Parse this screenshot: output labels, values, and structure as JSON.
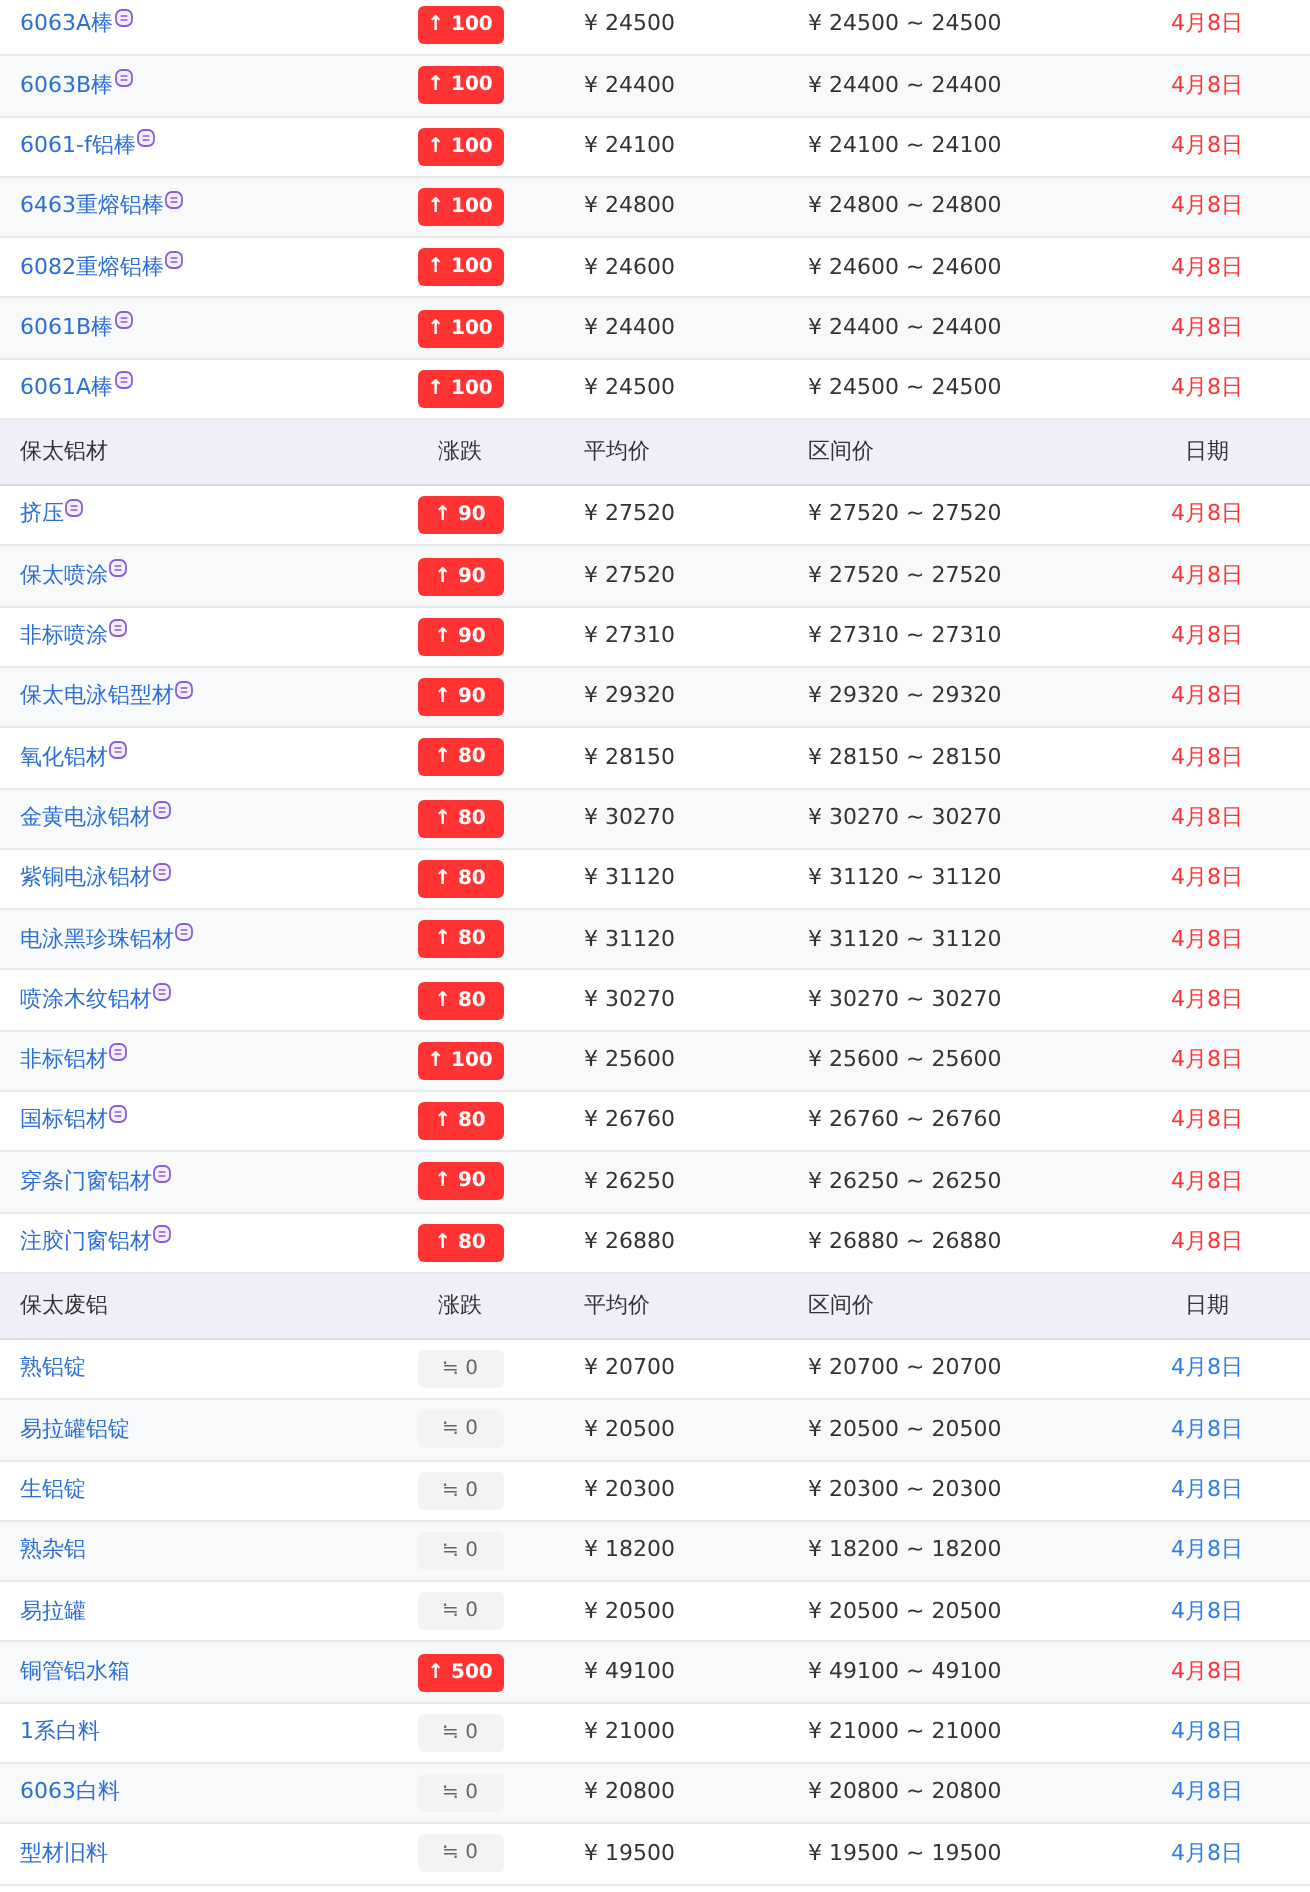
{
  "sections": [
    {
      "rows": [
        {
          "name": "6063A棒",
          "icon": true,
          "kind": "up",
          "change": "↑ 100",
          "avg": "¥ 24500",
          "range": "¥ 24500 ~ 24500",
          "date": "4月8日"
        },
        {
          "name": "6063B棒",
          "icon": true,
          "kind": "up",
          "change": "↑ 100",
          "avg": "¥ 24400",
          "range": "¥ 24400 ~ 24400",
          "date": "4月8日"
        },
        {
          "name": "6061-f铝棒",
          "icon": true,
          "kind": "up",
          "change": "↑ 100",
          "avg": "¥ 24100",
          "range": "¥ 24100 ~ 24100",
          "date": "4月8日"
        },
        {
          "name": "6463重熔铝棒",
          "icon": true,
          "kind": "up",
          "change": "↑ 100",
          "avg": "¥ 24800",
          "range": "¥ 24800 ~ 24800",
          "date": "4月8日"
        },
        {
          "name": "6082重熔铝棒",
          "icon": true,
          "kind": "up",
          "change": "↑ 100",
          "avg": "¥ 24600",
          "range": "¥ 24600 ~ 24600",
          "date": "4月8日"
        },
        {
          "name": "6061B棒",
          "icon": true,
          "kind": "up",
          "change": "↑ 100",
          "avg": "¥ 24400",
          "range": "¥ 24400 ~ 24400",
          "date": "4月8日"
        },
        {
          "name": "6061A棒",
          "icon": true,
          "kind": "up",
          "change": "↑ 100",
          "avg": "¥ 24500",
          "range": "¥ 24500 ~ 24500",
          "date": "4月8日"
        }
      ]
    },
    {
      "header": [
        "保太铝材",
        "涨跌",
        "平均价",
        "区间价",
        "日期"
      ],
      "rows": [
        {
          "name": "挤压",
          "icon": true,
          "kind": "up",
          "change": "↑ 90",
          "avg": "¥ 27520",
          "range": "¥ 27520 ~ 27520",
          "date": "4月8日"
        },
        {
          "name": "保太喷涂",
          "icon": true,
          "kind": "up",
          "change": "↑ 90",
          "avg": "¥ 27520",
          "range": "¥ 27520 ~ 27520",
          "date": "4月8日"
        },
        {
          "name": "非标喷涂",
          "icon": true,
          "kind": "up",
          "change": "↑ 90",
          "avg": "¥ 27310",
          "range": "¥ 27310 ~ 27310",
          "date": "4月8日"
        },
        {
          "name": "保太电泳铝型材",
          "icon": true,
          "kind": "up",
          "change": "↑ 90",
          "avg": "¥ 29320",
          "range": "¥ 29320 ~ 29320",
          "date": "4月8日"
        },
        {
          "name": "氧化铝材",
          "icon": true,
          "kind": "up",
          "change": "↑ 80",
          "avg": "¥ 28150",
          "range": "¥ 28150 ~ 28150",
          "date": "4月8日"
        },
        {
          "name": "金黄电泳铝材",
          "icon": true,
          "kind": "up",
          "change": "↑ 80",
          "avg": "¥ 30270",
          "range": "¥ 30270 ~ 30270",
          "date": "4月8日"
        },
        {
          "name": "紫铜电泳铝材",
          "icon": true,
          "kind": "up",
          "change": "↑ 80",
          "avg": "¥ 31120",
          "range": "¥ 31120 ~ 31120",
          "date": "4月8日"
        },
        {
          "name": "电泳黑珍珠铝材",
          "icon": true,
          "kind": "up",
          "change": "↑ 80",
          "avg": "¥ 31120",
          "range": "¥ 31120 ~ 31120",
          "date": "4月8日"
        },
        {
          "name": "喷涂木纹铝材",
          "icon": true,
          "kind": "up",
          "change": "↑ 80",
          "avg": "¥ 30270",
          "range": "¥ 30270 ~ 30270",
          "date": "4月8日"
        },
        {
          "name": "非标铝材",
          "icon": true,
          "kind": "up",
          "change": "↑ 100",
          "avg": "¥ 25600",
          "range": "¥ 25600 ~ 25600",
          "date": "4月8日"
        },
        {
          "name": "国标铝材",
          "icon": true,
          "kind": "up",
          "change": "↑ 80",
          "avg": "¥ 26760",
          "range": "¥ 26760 ~ 26760",
          "date": "4月8日"
        },
        {
          "name": "穿条门窗铝材",
          "icon": true,
          "kind": "up",
          "change": "↑ 90",
          "avg": "¥ 26250",
          "range": "¥ 26250 ~ 26250",
          "date": "4月8日"
        },
        {
          "name": "注胶门窗铝材",
          "icon": true,
          "kind": "up",
          "change": "↑ 80",
          "avg": "¥ 26880",
          "range": "¥ 26880 ~ 26880",
          "date": "4月8日"
        }
      ]
    },
    {
      "header": [
        "保太废铝",
        "涨跌",
        "平均价",
        "区间价",
        "日期"
      ],
      "rows": [
        {
          "name": "熟铝锭",
          "icon": false,
          "kind": "flat",
          "change": "≒ 0",
          "avg": "¥ 20700",
          "range": "¥ 20700 ~ 20700",
          "date": "4月8日"
        },
        {
          "name": "易拉罐铝锭",
          "icon": false,
          "kind": "flat",
          "change": "≒ 0",
          "avg": "¥ 20500",
          "range": "¥ 20500 ~ 20500",
          "date": "4月8日"
        },
        {
          "name": "生铝锭",
          "icon": false,
          "kind": "flat",
          "change": "≒ 0",
          "avg": "¥ 20300",
          "range": "¥ 20300 ~ 20300",
          "date": "4月8日"
        },
        {
          "name": "熟杂铝",
          "icon": false,
          "kind": "flat",
          "change": "≒ 0",
          "avg": "¥ 18200",
          "range": "¥ 18200 ~ 18200",
          "date": "4月8日"
        },
        {
          "name": "易拉罐",
          "icon": false,
          "kind": "flat",
          "change": "≒ 0",
          "avg": "¥ 20500",
          "range": "¥ 20500 ~ 20500",
          "date": "4月8日"
        },
        {
          "name": "铜管铝水箱",
          "icon": false,
          "kind": "up",
          "change": "↑ 500",
          "avg": "¥ 49100",
          "range": "¥ 49100 ~ 49100",
          "date": "4月8日"
        },
        {
          "name": "1系白料",
          "icon": false,
          "kind": "flat",
          "change": "≒ 0",
          "avg": "¥ 21000",
          "range": "¥ 21000 ~ 21000",
          "date": "4月8日"
        },
        {
          "name": "6063白料",
          "icon": false,
          "kind": "flat",
          "change": "≒ 0",
          "avg": "¥ 20800",
          "range": "¥ 20800 ~ 20800",
          "date": "4月8日"
        },
        {
          "name": "型材旧料",
          "icon": false,
          "kind": "flat",
          "change": "≒ 0",
          "avg": "¥ 19500",
          "range": "¥ 19500 ~ 19500",
          "date": "4月8日"
        }
      ]
    }
  ]
}
